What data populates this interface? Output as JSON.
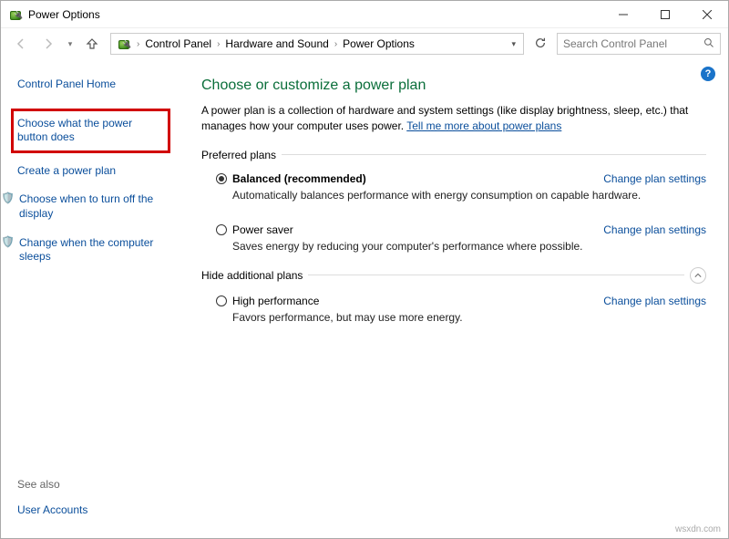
{
  "window": {
    "title": "Power Options"
  },
  "breadcrumb": {
    "items": [
      "Control Panel",
      "Hardware and Sound",
      "Power Options"
    ]
  },
  "search": {
    "placeholder": "Search Control Panel"
  },
  "sidebar": {
    "home": "Control Panel Home",
    "power_button": "Choose what the power button does",
    "create_plan": "Create a power plan",
    "turn_off_display": "Choose when to turn off the display",
    "computer_sleeps": "Change when the computer sleeps",
    "see_also_label": "See also",
    "user_accounts": "User Accounts"
  },
  "main": {
    "heading": "Choose or customize a power plan",
    "description": "A power plan is a collection of hardware and system settings (like display brightness, sleep, etc.) that manages how your computer uses power. ",
    "learn_more": "Tell me more about power plans",
    "preferred_label": "Preferred plans",
    "hide_additional_label": "Hide additional plans",
    "change_settings": "Change plan settings",
    "plans": {
      "balanced": {
        "name": "Balanced (recommended)",
        "desc": "Automatically balances performance with energy consumption on capable hardware."
      },
      "power_saver": {
        "name": "Power saver",
        "desc": "Saves energy by reducing your computer's performance where possible."
      },
      "high_perf": {
        "name": "High performance",
        "desc": "Favors performance, but may use more energy."
      }
    }
  },
  "watermark": "wsxdn.com"
}
